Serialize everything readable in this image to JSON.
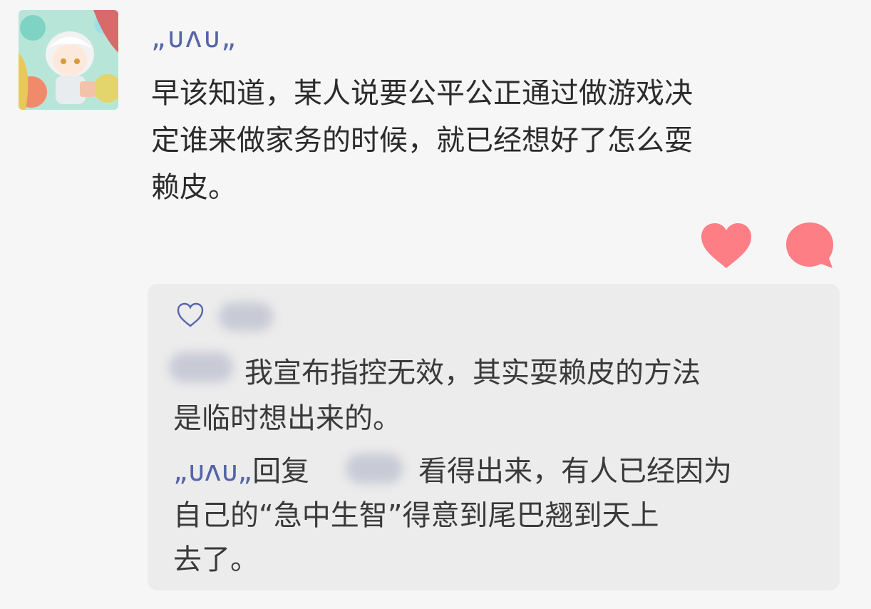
{
  "post": {
    "author": "„ᴜʌᴜ„",
    "lines": [
      "早该知道，某人说要公平公正通过做游戏决",
      "定谁来做家务的时候，就已经想好了怎么耍",
      "赖皮。"
    ]
  },
  "actions": {
    "like_icon": "heart-filled-icon",
    "comment_icon": "speech-bubble-icon",
    "accent_color": "#fe7e86"
  },
  "comments": {
    "like_icon": "heart-outline-icon",
    "first": {
      "line1": "我宣布指控无效，其实耍赖皮的方法",
      "line2": "是临时想出来的。"
    },
    "reply": {
      "author": "„ᴜʌᴜ„",
      "verb": "回复",
      "line1_text": "看得出来，有人已经因为",
      "line2": "自己的“急中生智”得意到尾巴翘到天上",
      "line3": "去了。"
    }
  }
}
